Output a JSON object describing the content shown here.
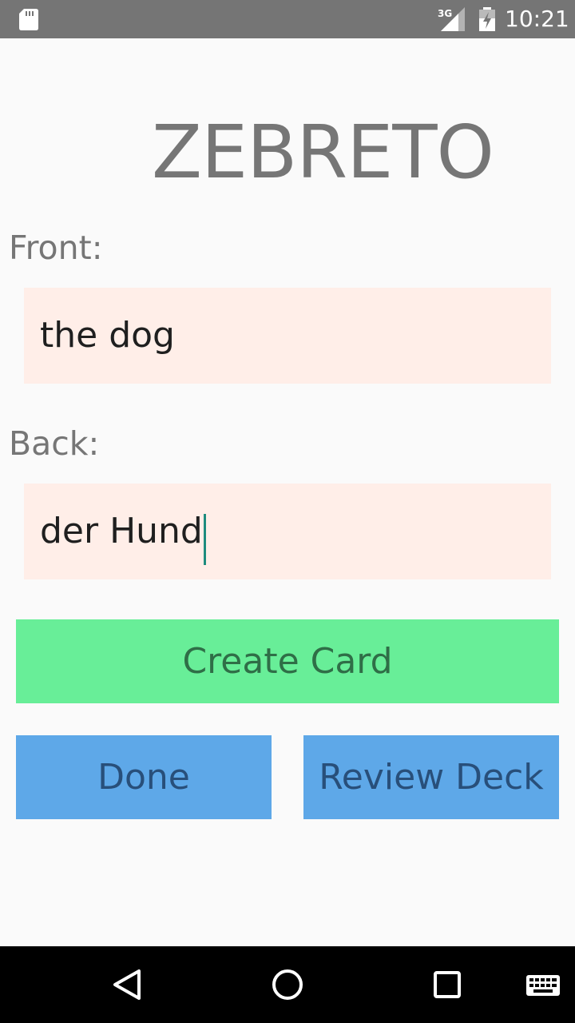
{
  "status_bar": {
    "time": "10:21",
    "network_type": "3G",
    "icons": [
      "sd-card-icon",
      "signal-icon",
      "battery-charging-icon"
    ]
  },
  "app": {
    "title": "ZEBRETO"
  },
  "form": {
    "front_label": "Front:",
    "front_value": "the dog",
    "back_label": "Back:",
    "back_value": "der Hund"
  },
  "buttons": {
    "create_card": "Create Card",
    "done": "Done",
    "review_deck": "Review Deck"
  },
  "nav_bar": {
    "icons": [
      "back-icon",
      "home-icon",
      "recents-icon",
      "keyboard-icon"
    ]
  },
  "colors": {
    "status_bar": "#757575",
    "title_text": "#767676",
    "input_background": "#ffeee8",
    "create_button": "#68ee98",
    "secondary_buttons": "#5ea8e8",
    "cursor": "#1e8c7e"
  }
}
